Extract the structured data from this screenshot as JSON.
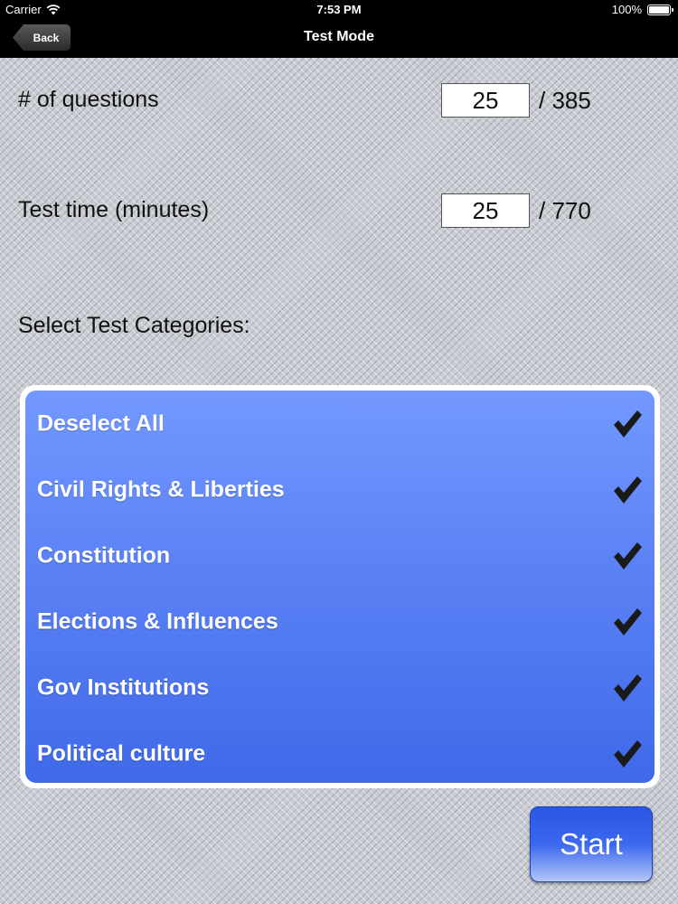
{
  "status": {
    "carrier": "Carrier",
    "time": "7:53 PM",
    "battery": "100%",
    "battery_level": 1.0
  },
  "nav": {
    "back_label": "Back",
    "title": "Test Mode"
  },
  "settings": {
    "questions": {
      "label": "# of questions",
      "value": "25",
      "total": "/ 385"
    },
    "time": {
      "label": "Test time (minutes)",
      "value": "25",
      "total": "/ 770"
    }
  },
  "categories": {
    "title": "Select Test Categories:",
    "items": [
      {
        "label": "Deselect All",
        "checked": true
      },
      {
        "label": "Civil Rights & Liberties",
        "checked": true
      },
      {
        "label": "Constitution",
        "checked": true
      },
      {
        "label": "Elections & Influences",
        "checked": true
      },
      {
        "label": "Gov Institutions",
        "checked": true
      },
      {
        "label": "Political culture",
        "checked": true
      }
    ]
  },
  "actions": {
    "start_label": "Start"
  },
  "colors": {
    "list_top": "#7298ff",
    "list_bottom": "#3f69e9",
    "start_button": "#2a57e4",
    "nav_bar": "#000000"
  },
  "icons": {
    "wifi": "wifi-icon",
    "check": "checkmark-icon",
    "back": "back-arrow-button"
  }
}
